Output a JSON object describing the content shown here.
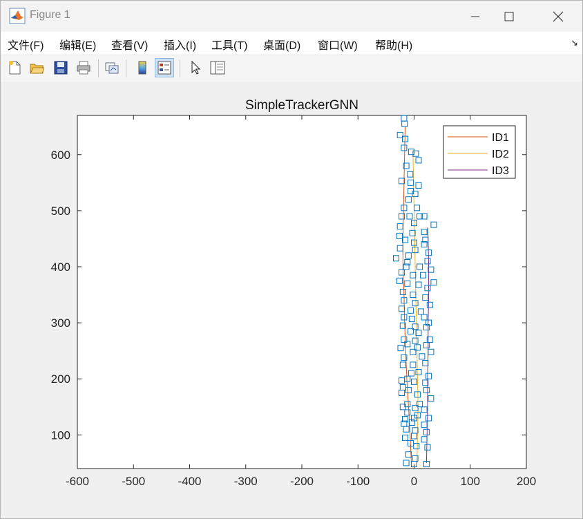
{
  "window": {
    "title": "Figure 1"
  },
  "menu": {
    "items": [
      "文件(F)",
      "编辑(E)",
      "查看(V)",
      "插入(I)",
      "工具(T)",
      "桌面(D)",
      "窗口(W)",
      "帮助(H)"
    ]
  },
  "toolbar": {
    "buttons": [
      {
        "name": "new-figure-icon"
      },
      {
        "name": "open-file-icon"
      },
      {
        "name": "save-icon"
      },
      {
        "name": "print-icon"
      },
      {
        "name": "link-plot-icon"
      },
      {
        "name": "insert-colorbar-icon"
      },
      {
        "name": "insert-legend-icon",
        "active": true
      },
      {
        "name": "edit-plot-arrow-icon"
      },
      {
        "name": "property-inspector-icon"
      }
    ]
  },
  "colors": {
    "id1": "#d95319",
    "id2": "#edb120",
    "id3": "#7e2f8e",
    "markers": "#0072bd"
  },
  "chart_data": {
    "type": "line",
    "title": "SimpleTrackerGNN",
    "xlabel": "",
    "ylabel": "",
    "xlim": [
      -600,
      200
    ],
    "ylim": [
      40,
      670
    ],
    "xticks": [
      -600,
      -500,
      -400,
      -300,
      -200,
      -100,
      0,
      100,
      200
    ],
    "yticks": [
      100,
      200,
      300,
      400,
      500,
      600
    ],
    "grid": false,
    "legend_position": "top-right",
    "series": [
      {
        "name": "ID1",
        "color": "#d95319",
        "points": [
          [
            -5,
            50
          ],
          [
            -7,
            100
          ],
          [
            -10,
            150
          ],
          [
            -13,
            200
          ],
          [
            -15,
            250
          ],
          [
            -17,
            300
          ],
          [
            -18,
            350
          ],
          [
            -20,
            400
          ],
          [
            -20,
            450
          ],
          [
            -19,
            500
          ],
          [
            -18,
            550
          ],
          [
            -17,
            600
          ],
          [
            -16,
            650
          ]
        ]
      },
      {
        "name": "ID2",
        "color": "#edb120",
        "points": [
          [
            5,
            50
          ],
          [
            6,
            100
          ],
          [
            7,
            150
          ],
          [
            6,
            200
          ],
          [
            5,
            250
          ],
          [
            4,
            300
          ],
          [
            3,
            350
          ],
          [
            2,
            400
          ],
          [
            1,
            450
          ],
          [
            0,
            500
          ],
          [
            -1,
            550
          ],
          [
            -2,
            600
          ]
        ]
      },
      {
        "name": "ID3",
        "color": "#7e2f8e",
        "points": [
          [
            22,
            50
          ],
          [
            23,
            100
          ],
          [
            24,
            150
          ],
          [
            24,
            200
          ],
          [
            25,
            250
          ],
          [
            25,
            300
          ],
          [
            26,
            350
          ],
          [
            26,
            400
          ],
          [
            25,
            450
          ],
          [
            24,
            470
          ]
        ]
      }
    ],
    "detections": [
      [
        -18,
        665
      ],
      [
        -17,
        655
      ],
      [
        -25,
        635
      ],
      [
        -16,
        628
      ],
      [
        -18,
        612
      ],
      [
        -5,
        605
      ],
      [
        3,
        602
      ],
      [
        8,
        590
      ],
      [
        -14,
        580
      ],
      [
        -7,
        565
      ],
      [
        -6,
        550
      ],
      [
        8,
        545
      ],
      [
        -22,
        553
      ],
      [
        -6,
        535
      ],
      [
        2,
        530
      ],
      [
        -10,
        520
      ],
      [
        -18,
        505
      ],
      [
        5,
        505
      ],
      [
        -22,
        490
      ],
      [
        -8,
        490
      ],
      [
        10,
        490
      ],
      [
        18,
        490
      ],
      [
        -25,
        472
      ],
      [
        0,
        478
      ],
      [
        35,
        475
      ],
      [
        -26,
        455
      ],
      [
        -3,
        460
      ],
      [
        18,
        462
      ],
      [
        20,
        448
      ],
      [
        -16,
        448
      ],
      [
        0,
        443
      ],
      [
        18,
        440
      ],
      [
        -25,
        433
      ],
      [
        2,
        430
      ],
      [
        26,
        425
      ],
      [
        -10,
        420
      ],
      [
        -32,
        415
      ],
      [
        -12,
        408
      ],
      [
        24,
        410
      ],
      [
        -14,
        400
      ],
      [
        10,
        400
      ],
      [
        -22,
        390
      ],
      [
        30,
        395
      ],
      [
        -2,
        385
      ],
      [
        16,
        385
      ],
      [
        -26,
        375
      ],
      [
        -12,
        370
      ],
      [
        35,
        372
      ],
      [
        8,
        368
      ],
      [
        24,
        362
      ],
      [
        -20,
        355
      ],
      [
        -2,
        350
      ],
      [
        20,
        345
      ],
      [
        -18,
        340
      ],
      [
        2,
        335
      ],
      [
        28,
        332
      ],
      [
        -22,
        325
      ],
      [
        -6,
        322
      ],
      [
        12,
        320
      ],
      [
        -18,
        310
      ],
      [
        -4,
        307
      ],
      [
        18,
        310
      ],
      [
        26,
        300
      ],
      [
        -20,
        295
      ],
      [
        2,
        293
      ],
      [
        22,
        292
      ],
      [
        -6,
        285
      ],
      [
        8,
        282
      ],
      [
        -18,
        270
      ],
      [
        2,
        268
      ],
      [
        28,
        270
      ],
      [
        -12,
        262
      ],
      [
        6,
        256
      ],
      [
        22,
        260
      ],
      [
        -24,
        255
      ],
      [
        -2,
        248
      ],
      [
        30,
        248
      ],
      [
        -18,
        238
      ],
      [
        14,
        240
      ],
      [
        -20,
        225
      ],
      [
        -2,
        225
      ],
      [
        20,
        228
      ],
      [
        -5,
        210
      ],
      [
        8,
        212
      ],
      [
        26,
        205
      ],
      [
        -12,
        200
      ],
      [
        -22,
        197
      ],
      [
        0,
        195
      ],
      [
        20,
        193
      ],
      [
        -20,
        185
      ],
      [
        -10,
        180
      ],
      [
        22,
        180
      ],
      [
        -22,
        175
      ],
      [
        6,
        172
      ],
      [
        30,
        165
      ],
      [
        -12,
        155
      ],
      [
        10,
        155
      ],
      [
        -20,
        150
      ],
      [
        2,
        148
      ],
      [
        18,
        145
      ],
      [
        -12,
        140
      ],
      [
        6,
        135
      ],
      [
        -16,
        128
      ],
      [
        0,
        130
      ],
      [
        26,
        130
      ],
      [
        -18,
        120
      ],
      [
        -4,
        122
      ],
      [
        18,
        118
      ],
      [
        -14,
        110
      ],
      [
        2,
        108
      ],
      [
        22,
        105
      ],
      [
        -16,
        95
      ],
      [
        0,
        98
      ],
      [
        18,
        92
      ],
      [
        -6,
        85
      ],
      [
        4,
        80
      ],
      [
        24,
        78
      ],
      [
        -10,
        65
      ],
      [
        -14,
        50
      ],
      [
        0,
        48
      ],
      [
        22,
        48
      ],
      [
        2,
        58
      ]
    ]
  }
}
